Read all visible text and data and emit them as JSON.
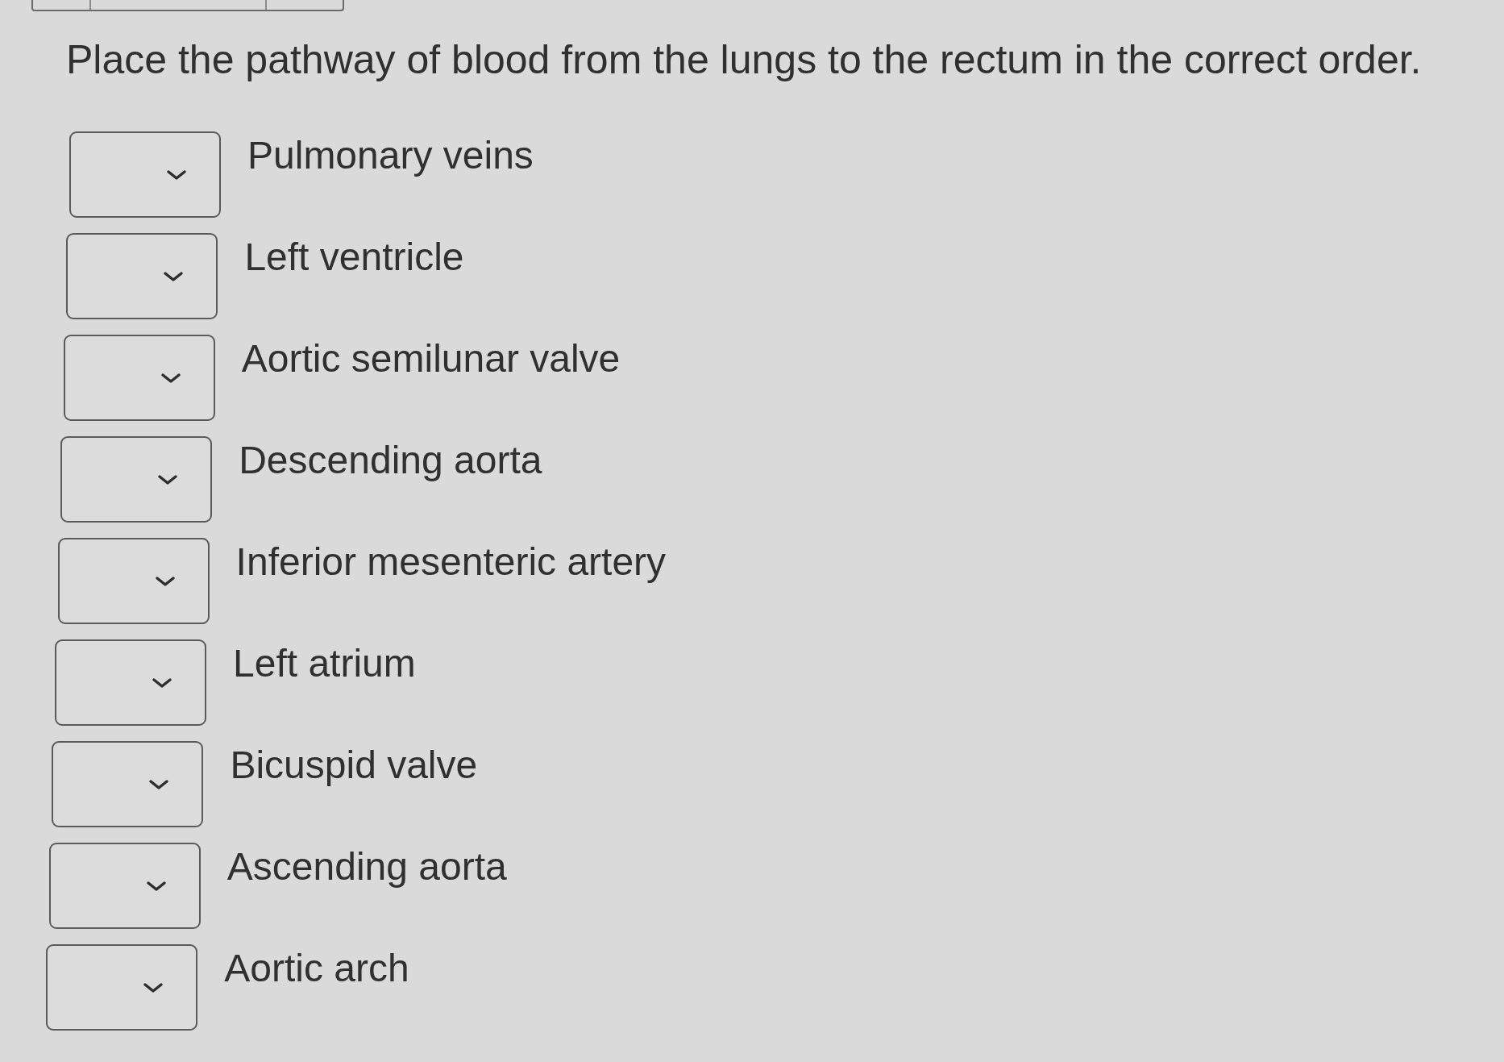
{
  "prompt": "Place the pathway of blood from the lungs to the rectum in the correct order.",
  "items": [
    {
      "label": "Pulmonary veins"
    },
    {
      "label": "Left ventricle"
    },
    {
      "label": "Aortic semilunar valve"
    },
    {
      "label": "Descending aorta"
    },
    {
      "label": "Inferior mesenteric artery"
    },
    {
      "label": "Left atrium"
    },
    {
      "label": "Bicuspid valve"
    },
    {
      "label": "Ascending aorta"
    },
    {
      "label": "Aortic arch"
    }
  ]
}
